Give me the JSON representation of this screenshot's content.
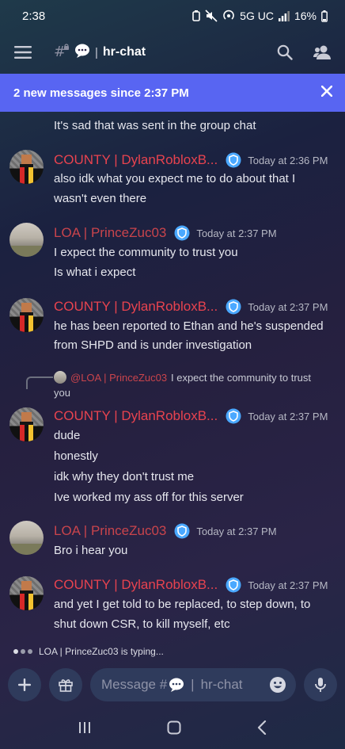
{
  "status_bar": {
    "time": "2:38",
    "network": "5G UC",
    "battery": "16%"
  },
  "header": {
    "channel_name": "hr-chat"
  },
  "banner": {
    "text": "2 new messages since 2:37 PM"
  },
  "continuation": "It's sad that was sent in the group chat",
  "messages": [
    {
      "author": "COUNTY | DylanRobloxB...",
      "time": "Today at 2:36 PM",
      "lines": [
        "also idk what you expect me to do about that I",
        "wasn't even there"
      ]
    },
    {
      "author": "LOA | PrinceZuc03",
      "time": "Today at 2:37 PM",
      "lines": [
        "I expect the community to trust you",
        "Is what i expect"
      ]
    },
    {
      "author": "COUNTY | DylanRobloxB...",
      "time": "Today at 2:37 PM",
      "lines": [
        "he has been reported to Ethan and he's suspended",
        "from SHPD and is under investigation"
      ]
    },
    {
      "author": "COUNTY | DylanRobloxB...",
      "time": "Today at 2:37 PM",
      "reply": {
        "author": "@LOA | PrinceZuc03",
        "text_line1": "I expect the community to trust",
        "text_line2": "you"
      },
      "lines": [
        "dude",
        "honestly",
        "idk why they don't trust me",
        "Ive worked my ass off for this server"
      ]
    },
    {
      "author": "LOA | PrinceZuc03",
      "time": "Today at 2:37 PM",
      "lines": [
        "Bro i hear you"
      ]
    },
    {
      "author": "COUNTY | DylanRobloxB...",
      "time": "Today at 2:37 PM",
      "lines": [
        "and yet I get told to be replaced, to step down, to",
        "shut down CSR, to kill myself, etc"
      ]
    }
  ],
  "typing": {
    "text": "LOA | PrinceZuc03 is typing..."
  },
  "composer": {
    "placeholder_prefix": "Message #",
    "placeholder_channel": "hr-chat"
  },
  "colors": {
    "banner": "#5865f2",
    "county_name": "#e8434f",
    "loa_name": "#c9444c",
    "badge": "#4aa8ff"
  }
}
